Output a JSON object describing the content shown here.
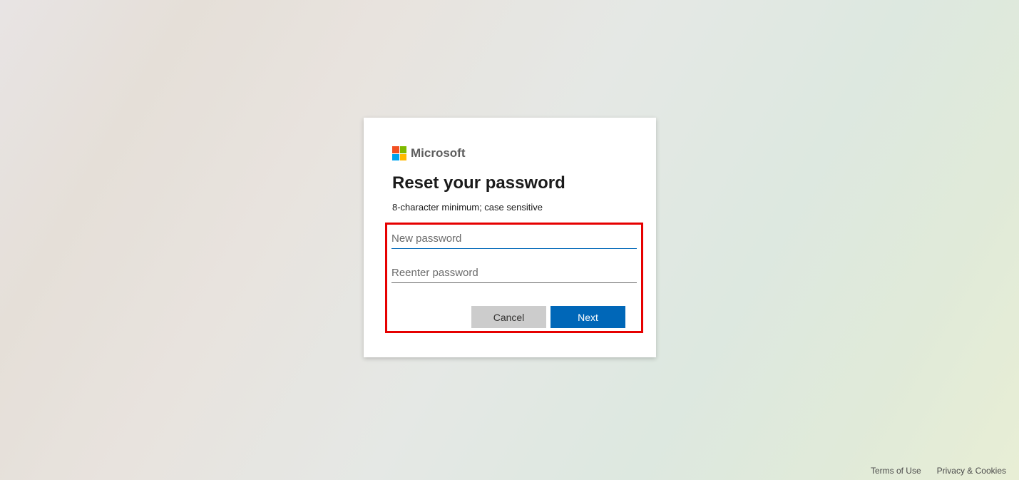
{
  "brand": {
    "name": "Microsoft"
  },
  "card": {
    "title": "Reset your password",
    "subtitle": "8-character minimum; case sensitive",
    "inputs": {
      "new_password": {
        "placeholder": "New password",
        "value": ""
      },
      "reenter_password": {
        "placeholder": "Reenter password",
        "value": ""
      }
    },
    "buttons": {
      "cancel": "Cancel",
      "next": "Next"
    }
  },
  "footer": {
    "terms": "Terms of Use",
    "privacy": "Privacy & Cookies"
  }
}
